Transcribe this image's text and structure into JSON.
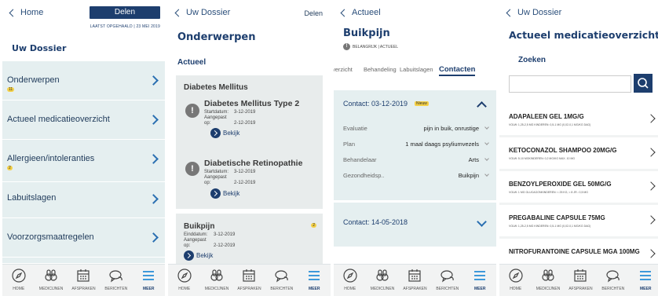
{
  "nav": [
    {
      "label": "HOME",
      "icon": "home-compass-icon"
    },
    {
      "label": "MEDICIJNEN",
      "icon": "medicine-icon"
    },
    {
      "label": "AFSPRAKEN",
      "icon": "calendar-icon"
    },
    {
      "label": "BERICHTEN",
      "icon": "messages-icon"
    },
    {
      "label": "MEER",
      "icon": "menu-icon"
    }
  ],
  "panel1": {
    "back_label": "Home",
    "share_label": "Delen",
    "last_updated": "LAATST OPGEHAALD | 23 MEI 2019",
    "title": "Uw Dossier",
    "items": [
      {
        "label": "Onderwerpen",
        "badge": "11"
      },
      {
        "label": "Actueel medicatieoverzicht",
        "badge": ""
      },
      {
        "label": "Allergieen/intoleranties",
        "badge": "2"
      },
      {
        "label": "Labuitslagen",
        "badge": ""
      },
      {
        "label": "Voorzorgsmaatregelen",
        "badge": ""
      }
    ]
  },
  "panel2": {
    "back_label": "Uw Dossier",
    "share_label": "Delen",
    "title": "Onderwerpen",
    "section": "Actueel",
    "card1": {
      "header": "Diabetes Mellitus",
      "items": [
        {
          "title": "Diabetes Mellitus Type 2",
          "start_label": "Startdatum:",
          "start": "3-12-2019",
          "adjusted_label": "Aangepast op:",
          "adjusted": "2-12-2019",
          "action": "Bekijk"
        },
        {
          "title": "Diabetische Retinopathie",
          "start_label": "Startdatum:",
          "start": "3-12-2019",
          "adjusted_label": "Aangepast op:",
          "adjusted": "2-12-2019",
          "action": "Bekijk"
        }
      ]
    },
    "card2": {
      "header": "Buikpijn",
      "badge": "2",
      "end_label": "Einddatum:",
      "end": "3-12-2019",
      "adjusted_label": "Aangepast op:",
      "adjusted": "2-12-2019",
      "action": "Bekijk"
    }
  },
  "panel3": {
    "back_label": "Actueel",
    "title": "Buikpijn",
    "subtitle_icon": "!",
    "subtitle": "BELANGRIJK  |  ACTUEEL",
    "tabs": [
      "verzicht",
      "Behandeling",
      "Labuitslagen",
      "Contacten"
    ],
    "contact1": {
      "header": "Contact: 03-12-2019",
      "new_badge": "Nieuw",
      "rows": [
        {
          "key": "Evaluatie",
          "value": "pijn in buik, onrustige"
        },
        {
          "key": "Plan",
          "value": "1 maal daags psyliumvezels"
        },
        {
          "key": "Behandelaar",
          "value": "Arts"
        },
        {
          "key": "Gezondheidsp..",
          "value": "Buikpijn"
        }
      ]
    },
    "contact2": {
      "header": "Contact: 14-05-2018"
    }
  },
  "panel4": {
    "back_label": "Uw Dossier",
    "title": "Actueel medicatieoverzicht",
    "search_label": "Zoeken",
    "search_value": "",
    "medications": [
      {
        "name": "ADAPALEEN GEL 1MG/G",
        "dose": "VOLW: 1,25-2,5 MG KINDEREN: 0,5-1 MG (0,02-0,1 MG/KG DAG)"
      },
      {
        "name": "KETOCONAZOL SHAMPOO 20MG/G",
        "dose": "VOLW: 5-10 MGKINDEREN: 0,2 MG/KG MAX. 10 MG"
      },
      {
        "name": "BENZOYLPEROXIDE GEL  50MG/G",
        "dose": "VOLW: 1 MG GLUCAGONKINDEREN: < 25 KG, < 8 JR.: 0,5 MG"
      },
      {
        "name": "PREGABALINE CAPSULE  75MG",
        "dose": "VOLW: 1,25-2,5 MG KINDEREN: 0,5-1 MG (0,02-0,1 MG/KG DAG)"
      },
      {
        "name": "NITROFURANTOINE CAPSULE MGA 100MG",
        "dose": ""
      }
    ]
  },
  "colors": {
    "primary": "#1d3e6e",
    "accent": "#2a6fb1",
    "badge": "#f4d046",
    "list_bg": "#e5eff0"
  }
}
